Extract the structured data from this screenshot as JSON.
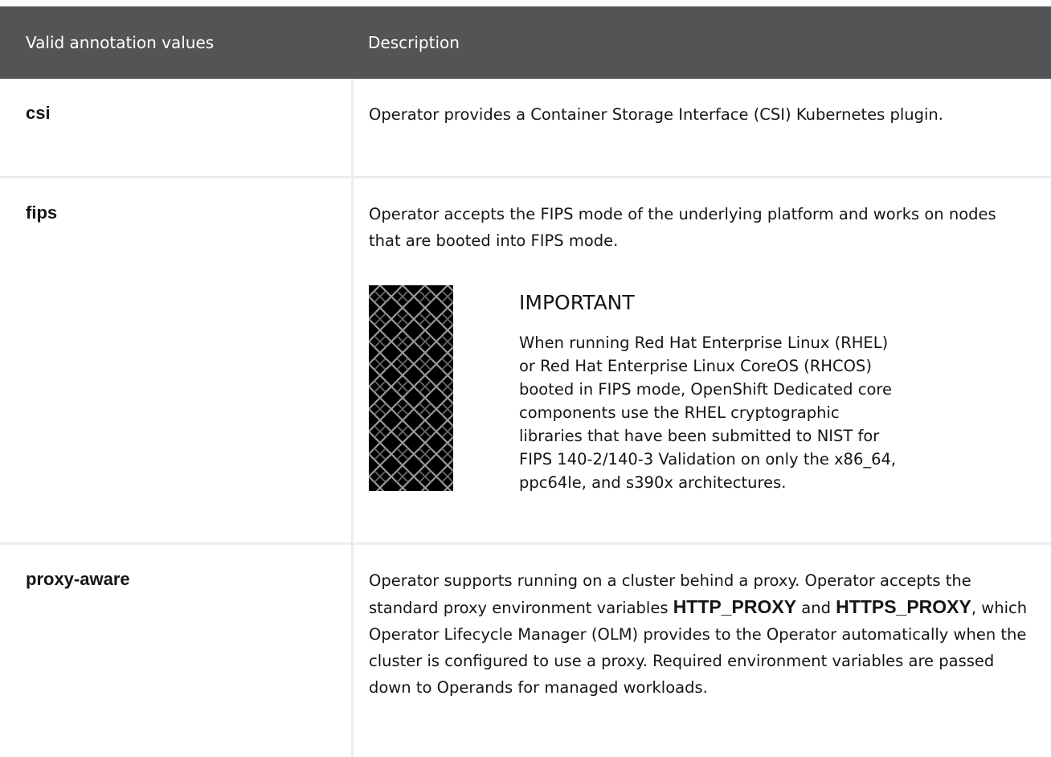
{
  "table": {
    "headers": {
      "col1": "Valid annotation values",
      "col2": "Description"
    },
    "rows": [
      {
        "key": "csi",
        "description": "Operator provides a Container Storage Interface (CSI) Kubernetes plugin."
      },
      {
        "key": "fips",
        "description": "Operator accepts the FIPS mode of the underlying platform and works on nodes that are booted into FIPS mode.",
        "admonition": {
          "title": "IMPORTANT",
          "text": "When running Red Hat Enterprise Linux (RHEL) or Red Hat Enterprise Linux CoreOS (RHCOS) booted in FIPS mode, OpenShift Dedicated core components use the RHEL cryptographic libraries that have been submitted to NIST for FIPS 140-2/140-3 Validation on only the x86_64, ppc64le, and s390x architectures.",
          "icon": "important-pattern-icon"
        }
      },
      {
        "key": "proxy-aware",
        "description_part1": "Operator supports running on a cluster behind a proxy. Operator accepts the standard proxy environment variables ",
        "code1": "HTTP_PROXY",
        "description_part2": " and ",
        "code2": "HTTPS_PROXY",
        "description_part3": ", which Operator Lifecycle Manager (OLM) provides to the Operator automatically when the cluster is configured to use a proxy. Required environment variables are passed down to Operands for managed workloads."
      }
    ]
  },
  "colors": {
    "header_bg": "#545454",
    "header_text": "#ffffff",
    "border": "#ededed",
    "text": "#151515"
  }
}
